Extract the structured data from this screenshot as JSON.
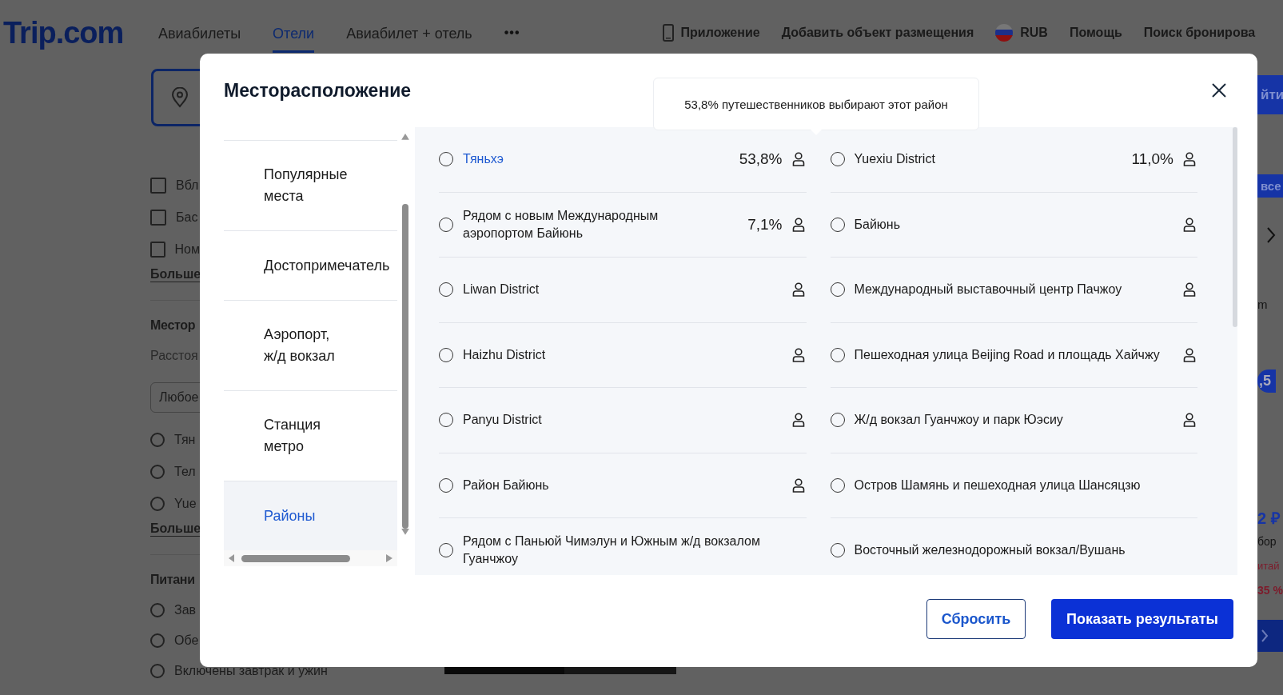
{
  "header": {
    "logo": "Trip.com",
    "nav": [
      {
        "label": "Авиабилеты",
        "selected": false
      },
      {
        "label": "Отели",
        "selected": true
      },
      {
        "label": "Авиабилет + отель",
        "selected": false
      }
    ],
    "more": "•••",
    "links": [
      {
        "kind": "app",
        "label": "Приложение"
      },
      {
        "kind": "text",
        "label": "Добавить объект размещения"
      },
      {
        "kind": "currency",
        "label": "RUB"
      },
      {
        "kind": "text",
        "label": "Помощь"
      },
      {
        "kind": "text",
        "label": "Поиск бронирова"
      }
    ]
  },
  "background_left": {
    "checkboxes": [
      {
        "label": "Вбл",
        "checked": false
      },
      {
        "label": "Бас",
        "checked": false
      },
      {
        "label": "Ном",
        "checked": false
      }
    ],
    "more_1": "Больше",
    "section_1": "Местор",
    "subtitle": "Расстоя",
    "select": "Любое",
    "radios_1": [
      {
        "label": "Тян",
        "selected": false
      },
      {
        "label": "Тел",
        "selected": false
      },
      {
        "label": "Yue",
        "selected": false
      }
    ],
    "more_2": "Больше",
    "section_2": "Питани",
    "radios_2": [
      {
        "label": "Зав",
        "selected": false
      },
      {
        "label": "Обе",
        "selected": false
      },
      {
        "label": "Включены завтрак и ужин",
        "selected": false
      }
    ]
  },
  "background_right": {
    "search_button": "йти",
    "all_button": "все",
    "sort": "m",
    "score": ",5",
    "price": "2 ₽",
    "note": "бор",
    "tag": "итай",
    "discount": "35 %"
  },
  "modal": {
    "title": "Месторасположение",
    "tooltip": "53,8% путешественников выбирают этот район",
    "categories": [
      {
        "label": "Популярные места",
        "selected": false
      },
      {
        "label": "Достопримечатель",
        "selected": false
      },
      {
        "label": "Аэропорт, ж/д вокзал",
        "selected": false
      },
      {
        "label": "Станция метро",
        "selected": false
      },
      {
        "label": "Районы",
        "selected": true
      }
    ],
    "districts": [
      {
        "label": "Тяньхэ",
        "selected": false,
        "hovered": true,
        "share": "53,8%",
        "popular": true
      },
      {
        "label": "Yuexiu District",
        "selected": false,
        "hovered": false,
        "share": "11,0%",
        "popular": true
      },
      {
        "label": "Рядом с новым Международным аэропортом Байюнь",
        "selected": false,
        "hovered": false,
        "share": "7,1%",
        "popular": true
      },
      {
        "label": "Байюнь",
        "selected": false,
        "hovered": false,
        "popular": true
      },
      {
        "label": "Liwan District",
        "selected": false,
        "hovered": false,
        "popular": true
      },
      {
        "label": "Международный выставочный центр Пачжоу",
        "selected": false,
        "hovered": false,
        "popular": true
      },
      {
        "label": "Haizhu District",
        "selected": false,
        "hovered": false,
        "popular": true
      },
      {
        "label": "Пешеходная улица Beijing Road и площадь Хайчжу",
        "selected": false,
        "hovered": false,
        "popular": true
      },
      {
        "label": "Panyu District",
        "selected": false,
        "hovered": false,
        "popular": true
      },
      {
        "label": "Ж/д вокзал Гуанчжоу и парк Юэсиу",
        "selected": false,
        "hovered": false,
        "popular": true
      },
      {
        "label": "Район Байюнь",
        "selected": false,
        "hovered": false,
        "popular": true
      },
      {
        "label": "Остров Шамянь и пешеходная улица Шансяцзю",
        "selected": false,
        "hovered": false,
        "popular": false
      },
      {
        "label": "Рядом с Паньюй Чимэлун и Южным ж/д вокзалом Гуанчжоу",
        "selected": false,
        "hovered": false,
        "popular": false
      },
      {
        "label": "Восточный железнодорожный вокзал/Вушань",
        "selected": false,
        "hovered": false,
        "popular": false
      }
    ],
    "buttons": [
      {
        "kind": "secondary",
        "label": "Сбросить"
      },
      {
        "kind": "primary",
        "label": "Показать результаты"
      }
    ]
  }
}
